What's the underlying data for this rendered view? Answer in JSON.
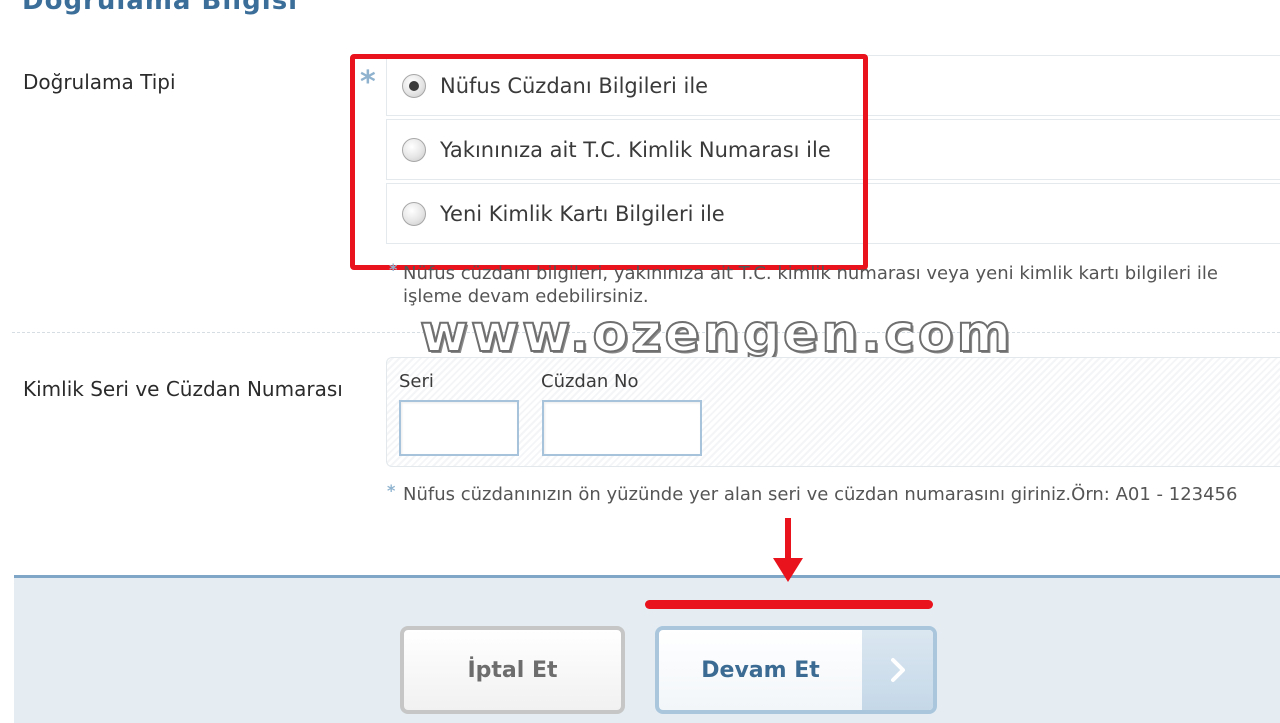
{
  "header": {
    "title": "Doğrulama Bilgisi"
  },
  "verification": {
    "label": "Doğrulama Tipi",
    "required_mark": "*",
    "options": [
      {
        "label": "Nüfus Cüzdanı Bilgileri ile",
        "selected": true
      },
      {
        "label": "Yakınınıza ait T.C. Kimlik Numarası ile",
        "selected": false
      },
      {
        "label": "Yeni Kimlik Kartı Bilgileri ile",
        "selected": false
      }
    ],
    "hint_mark": "*",
    "hint": "Nüfus cüzdanı bilgileri, yakınınıza ait T.C. kimlik numarası veya yeni kimlik kartı bilgileri ile işleme devam edebilirsiniz."
  },
  "watermark": "www.ozengen.com",
  "identity": {
    "label": "Kimlik Seri ve Cüzdan Numarası",
    "serial_label": "Seri",
    "serial_value": "",
    "wallet_label": "Cüzdan No",
    "wallet_value": "",
    "hint_mark": "*",
    "hint": "Nüfus cüzdanınızın ön yüzünde yer alan seri ve cüzdan numarasını giriniz.Örn: A01 - 123456"
  },
  "buttons": {
    "cancel": "İptal Et",
    "continue": "Devam Et"
  },
  "colors": {
    "accent": "#3b6b92",
    "annotation_red": "#e8131c",
    "footer_bg": "#e5edf3"
  }
}
